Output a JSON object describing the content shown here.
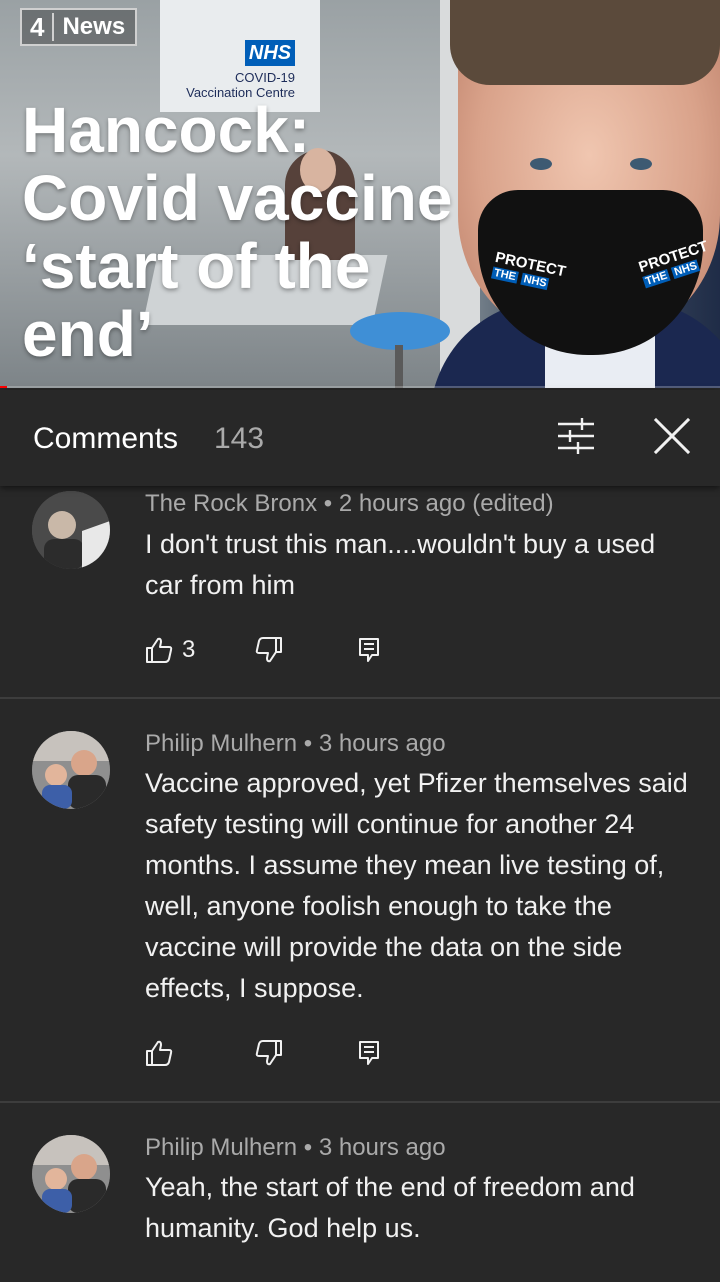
{
  "video": {
    "channel_number": "4",
    "channel_name": "News",
    "headline": "Hancock: Covid vaccine ‘start of the end’",
    "sign_logo": "NHS",
    "sign_line1": "COVID-19",
    "sign_line2": "Vaccination Centre",
    "mask_text_left_1": "PROTECT",
    "mask_text_left_2": "THE",
    "mask_text_left_3": "NHS",
    "mask_text_right_1": "PROTECT",
    "mask_text_right_2": "THE",
    "mask_text_right_3": "NHS",
    "progress": 0.01
  },
  "comments_panel": {
    "title": "Comments",
    "count": "143"
  },
  "comments": [
    {
      "author": "The Rock Bronx",
      "time": "2 hours ago (edited)",
      "text": "I don't trust this man....wouldn't buy a used car from him",
      "likes": "3"
    },
    {
      "author": "Philip Mulhern",
      "time": "3 hours ago",
      "text": "Vaccine approved, yet Pfizer themselves said safety testing will continue for another 24 months. I assume they mean live testing of, well, anyone foolish enough to take the vaccine will provide the data on the side effects, I suppose.",
      "likes": ""
    },
    {
      "author": "Philip Mulhern",
      "time": "3 hours ago",
      "text": "Yeah, the start of the end of freedom and humanity. God help us.",
      "likes": ""
    }
  ],
  "colors": {
    "background": "#282828",
    "text_primary": "#f1f1f1",
    "text_secondary": "#aaaaaa",
    "progress": "#ff0000",
    "nhs_blue": "#005eb8"
  },
  "icons": {
    "like": "thumbs-up-icon",
    "dislike": "thumbs-down-icon",
    "reply": "reply-icon",
    "sort": "sort-icon",
    "close": "close-icon"
  }
}
